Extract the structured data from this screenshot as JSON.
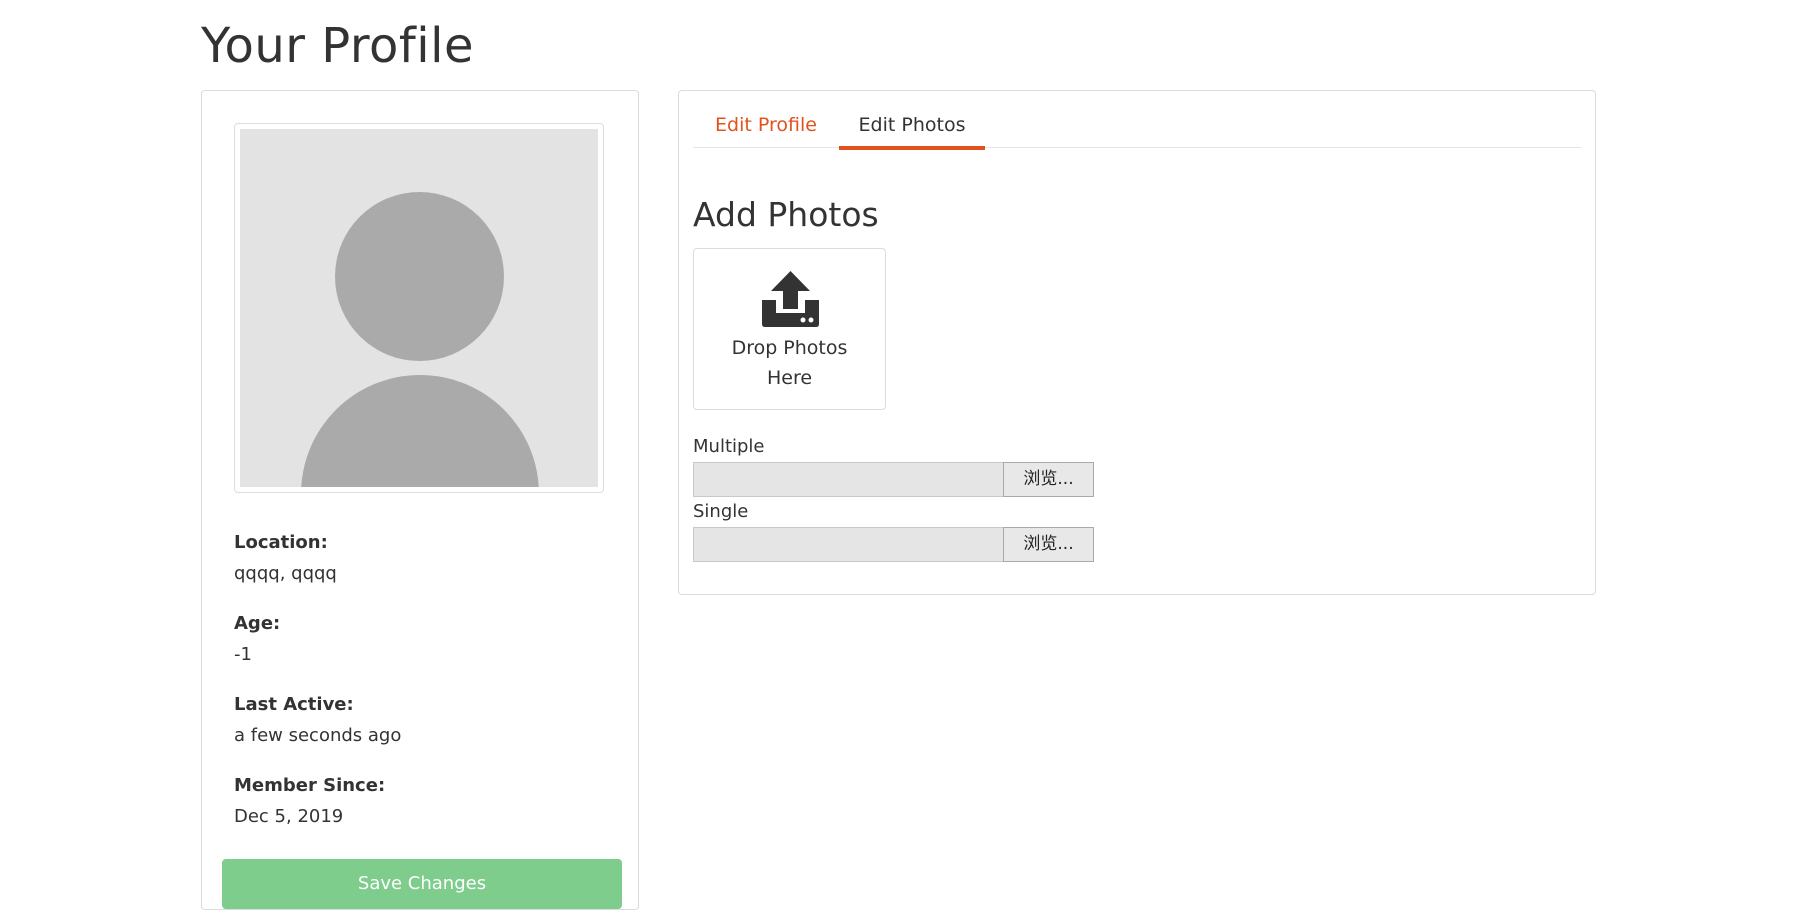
{
  "page": {
    "title": "Your Profile"
  },
  "profile": {
    "avatar_icon": "default-user-avatar",
    "fields": [
      {
        "label": "Location:",
        "value": "qqqq, qqqq"
      },
      {
        "label": "Age:",
        "value": "-1"
      },
      {
        "label": "Last Active:",
        "value": "a few seconds ago"
      },
      {
        "label": "Member Since:",
        "value": "Dec 5, 2019"
      }
    ],
    "save_button": "Save Changes"
  },
  "tabs": [
    {
      "label": "Edit Profile",
      "active": false
    },
    {
      "label": "Edit Photos",
      "active": true
    }
  ],
  "photos": {
    "heading": "Add Photos",
    "drop_zone_text": "Drop Photos Here",
    "upload_icon": "upload-icon",
    "multiple_label": "Multiple",
    "single_label": "Single",
    "browse_label": "浏览..."
  },
  "colors": {
    "accent": "#e2521d",
    "save_button": "#7ecd8c",
    "avatar_bg": "#e3e3e3",
    "avatar_fg": "#aaaaaa"
  }
}
